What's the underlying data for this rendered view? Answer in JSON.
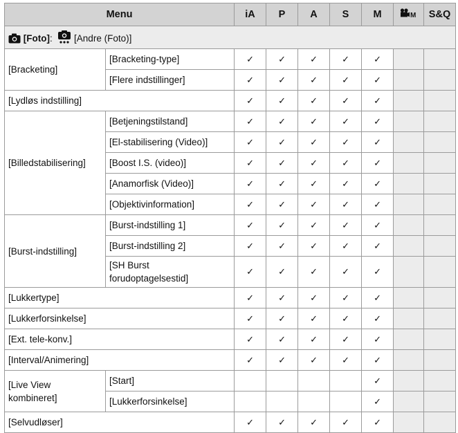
{
  "header": {
    "menu": "Menu",
    "modes": [
      "iA",
      "P",
      "A",
      "S",
      "M"
    ],
    "video_mode_icon": "movie-camera-m-icon",
    "sq": "S&Q"
  },
  "section": {
    "foto_label": "[Foto]",
    "colon": ":",
    "andre_label": "[Andre (Foto)]",
    "camera_icon": "camera-icon",
    "other_icon": "other-photo-icon"
  },
  "check_mark": "✓",
  "rows": {
    "bracketing": "[Bracketing]",
    "bracketing_type": "[Bracketing-type]",
    "flere": "[Flere indstillinger]",
    "lydlos": "[Lydløs indstilling]",
    "billed": "[Billedstabilisering]",
    "betjening": "[Betjeningstilstand]",
    "elstab": "[El-stabilisering (Video)]",
    "boost": "[Boost I.S. (video)]",
    "anamorf": "[Anamorfisk (Video)]",
    "objektiv": "[Objektivinformation]",
    "burst": "[Burst-indstilling]",
    "burst1": "[Burst-indstilling 1]",
    "burst2": "[Burst-indstilling 2]",
    "shburst_1": "[SH Burst",
    "shburst_2": "forudoptagelsestid]",
    "lukkertype": "[Lukkertype]",
    "lukkerfors": "[Lukkerforsinkelse]",
    "exttele": "[Ext. tele-konv.]",
    "interval": "[Interval/Animering]",
    "liveview_1": "[Live View",
    "liveview_2": "kombineret]",
    "start": "[Start]",
    "lukkerfors2": "[Lukkerforsinkelse]",
    "selvud": "[Selvudløser]"
  }
}
